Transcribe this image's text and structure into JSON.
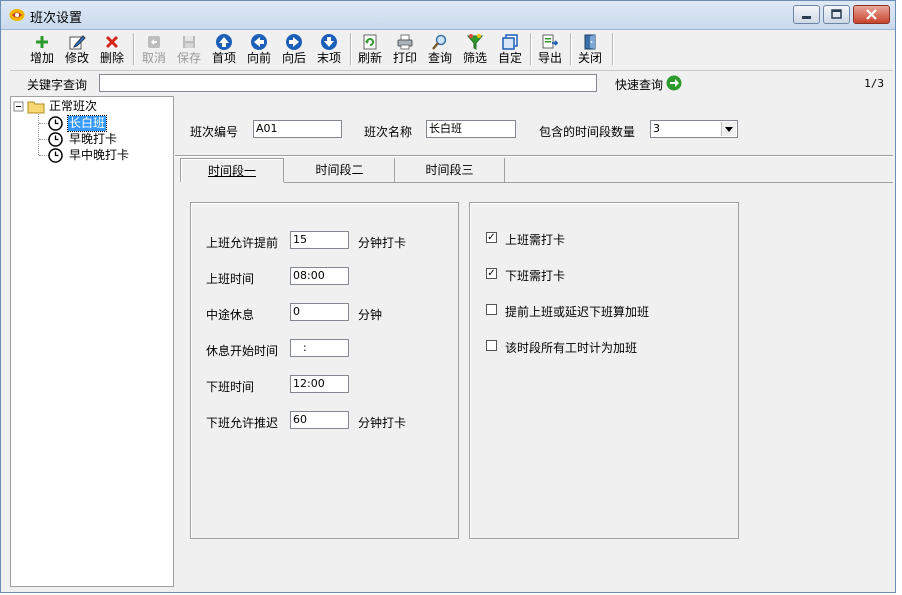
{
  "window": {
    "title": "班次设置",
    "controls": [
      "minimize-icon",
      "maximize-icon",
      "close-icon"
    ]
  },
  "toolbar": {
    "buttons": [
      {
        "label": "增加",
        "icon": "plus-icon",
        "enabled": true
      },
      {
        "label": "修改",
        "icon": "edit-icon",
        "enabled": true
      },
      {
        "label": "删除",
        "icon": "delete-x-icon",
        "enabled": true
      },
      {
        "label": "取消",
        "icon": "cancel-icon",
        "enabled": false
      },
      {
        "label": "保存",
        "icon": "save-icon",
        "enabled": false
      },
      {
        "label": "首项",
        "icon": "arrow-up-icon",
        "enabled": true
      },
      {
        "label": "向前",
        "icon": "arrow-left-icon",
        "enabled": true
      },
      {
        "label": "向后",
        "icon": "arrow-right-icon",
        "enabled": true
      },
      {
        "label": "末项",
        "icon": "arrow-down-icon",
        "enabled": true
      },
      {
        "label": "刷新",
        "icon": "refresh-icon",
        "enabled": true
      },
      {
        "label": "打印",
        "icon": "printer-icon",
        "enabled": true
      },
      {
        "label": "查询",
        "icon": "magnifier-icon",
        "enabled": true
      },
      {
        "label": "筛选",
        "icon": "filter-funnel-icon",
        "enabled": true
      },
      {
        "label": "自定",
        "icon": "customize-icon",
        "enabled": true
      },
      {
        "label": "导出",
        "icon": "export-icon",
        "enabled": true
      },
      {
        "label": "关闭",
        "icon": "exit-door-icon",
        "enabled": true
      }
    ]
  },
  "search": {
    "keyword_label": "关键字查询",
    "keyword_value": "",
    "quick_label": "快速查询",
    "page_indicator": "1/3"
  },
  "tree": {
    "root": "正常班次",
    "items": [
      {
        "label": "长白班",
        "selected": true
      },
      {
        "label": "早晚打卡",
        "selected": false
      },
      {
        "label": "早中晚打卡",
        "selected": false
      }
    ]
  },
  "header": {
    "code_label": "班次编号",
    "code_value": "A01",
    "name_label": "班次名称",
    "name_value": "长白班",
    "count_label": "包含的时间段数量",
    "count_value": "3"
  },
  "tabs": [
    {
      "label": "时间段一",
      "active": true
    },
    {
      "label": "时间段二",
      "active": false
    },
    {
      "label": "时间段三",
      "active": false
    }
  ],
  "fields": {
    "early_label": "上班允许提前",
    "early_value": "15",
    "early_suffix": "分钟打卡",
    "start_label": "上班时间",
    "start_value": "08:00",
    "break_label": "中途休息",
    "break_value": "0",
    "break_suffix": "分钟",
    "break_start_label": "休息开始时间",
    "break_start_value": " :",
    "end_label": "下班时间",
    "end_value": "12:00",
    "late_label": "下班允许推迟",
    "late_value": "60",
    "late_suffix": "分钟打卡"
  },
  "options": [
    {
      "label": "上班需打卡",
      "checked": true
    },
    {
      "label": "下班需打卡",
      "checked": true
    },
    {
      "label": "提前上班或延迟下班算加班",
      "checked": false
    },
    {
      "label": "该时段所有工时计为加班",
      "checked": false
    }
  ],
  "colors": {
    "selection": "#3399ff",
    "window_bg": "#f0f0f0",
    "nav_blue": "#1c5fb8",
    "add_green": "#2e9a2e",
    "delete_red": "#d4271a"
  }
}
